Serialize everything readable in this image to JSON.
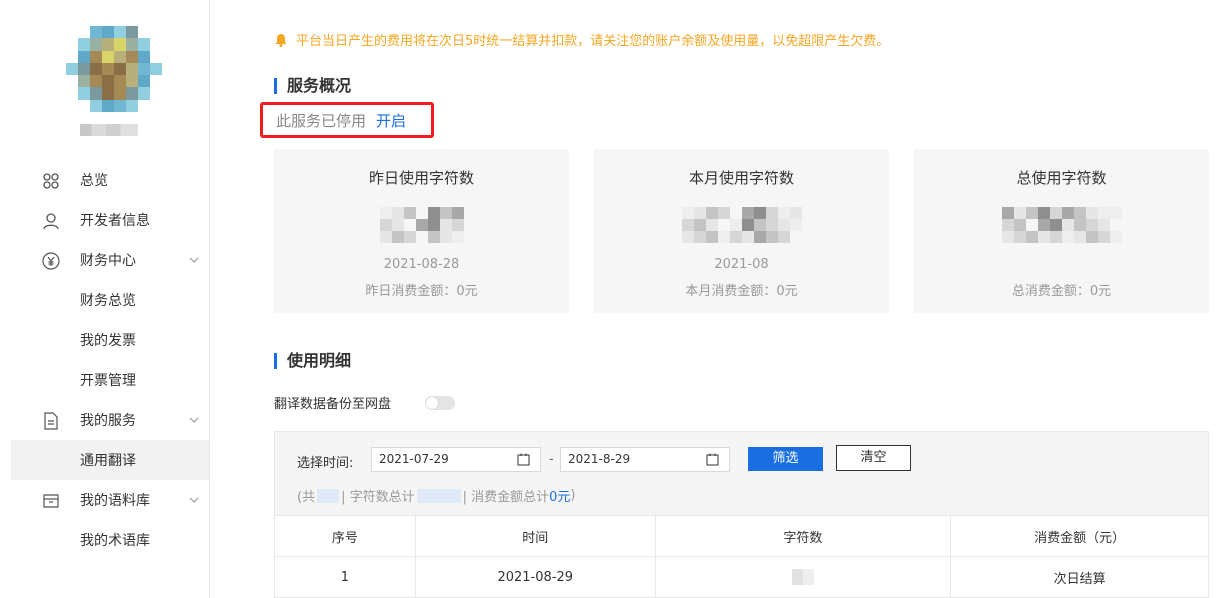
{
  "notice": "平台当日产生的费用将在次日5时统一结算并扣款，请关注您的账户余额及使用量，以免超限产生欠费。",
  "sidebar": {
    "items": [
      {
        "label": "总览",
        "icon": "grid-icon"
      },
      {
        "label": "开发者信息",
        "icon": "user-icon"
      },
      {
        "label": "财务中心",
        "icon": "yen-icon",
        "expandable": true
      },
      {
        "label": "财务总览",
        "sub": true
      },
      {
        "label": "我的发票",
        "sub": true
      },
      {
        "label": "开票管理",
        "sub": true
      },
      {
        "label": "我的服务",
        "icon": "document-icon",
        "expandable": true
      },
      {
        "label": "通用翻译",
        "sub": true,
        "active": true
      },
      {
        "label": "我的语料库",
        "icon": "inbox-icon",
        "expandable": true
      },
      {
        "label": "我的术语库",
        "sub": true
      }
    ]
  },
  "overview": {
    "title": "服务概况",
    "status_text": "此服务已停用",
    "open_label": "开启",
    "cards": [
      {
        "title": "昨日使用字符数",
        "date": "2021-08-28",
        "fee": "昨日消费金额：0元"
      },
      {
        "title": "本月使用字符数",
        "date": "2021-08",
        "fee": "本月消费金额：0元"
      },
      {
        "title": "总使用字符数",
        "date": "",
        "fee": "总消费金额：0元"
      }
    ]
  },
  "details": {
    "title": "使用明细",
    "backup_label": "翻译数据备份至网盘",
    "backup_enabled": false,
    "filter": {
      "label": "选择时间:",
      "start": "2021-07-29",
      "end": "2021-8-29",
      "separator": "-",
      "filter_label": "筛选",
      "clear_label": "清空"
    },
    "summary": {
      "prefix": "(共",
      "chars_label": "| 字符数总计",
      "fee_label": "| 消费金额总计",
      "fee_value": "0元",
      "suffix": ")"
    },
    "table": {
      "headers": [
        "序号",
        "时间",
        "字符数",
        "消费金额（元）"
      ],
      "rows": [
        {
          "index": "1",
          "time": "2021-08-29",
          "fee": "次日结算"
        }
      ]
    }
  },
  "colors": {
    "accent": "#1a6fe0",
    "notice": "#f5a623",
    "highlight_border": "#ee1c1c"
  }
}
